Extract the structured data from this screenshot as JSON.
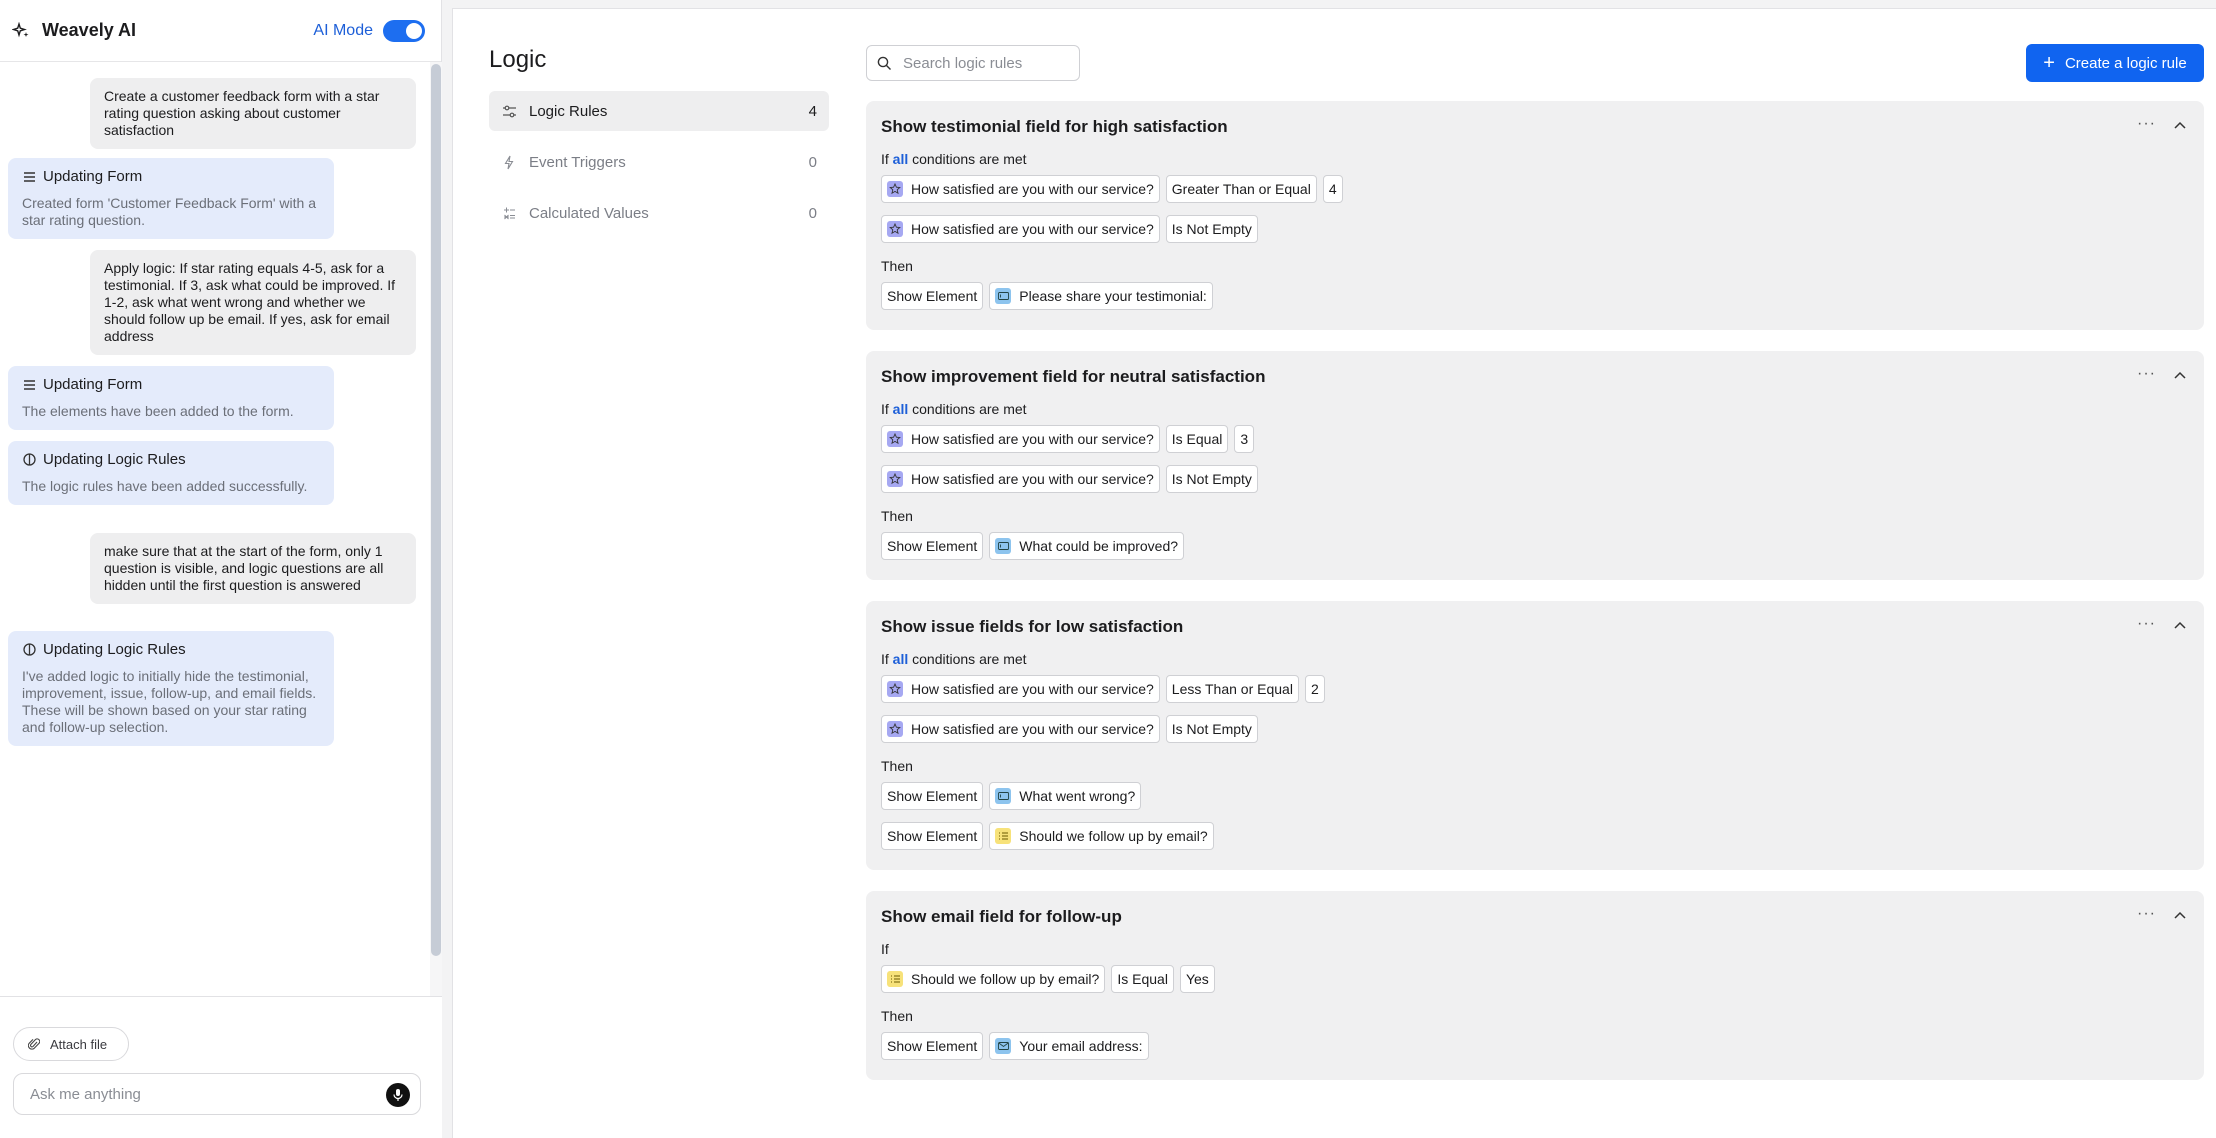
{
  "chat": {
    "brand": "Weavely AI",
    "ai_mode_label": "AI Mode",
    "messages": [
      {
        "role": "user",
        "text": "Create a customer feedback form with a star rating question asking about customer satisfaction"
      },
      {
        "role": "ai",
        "title": "Updating Form",
        "icon": "list-icon",
        "body": "Created form 'Customer Feedback Form' with a star rating question."
      },
      {
        "role": "user",
        "text": "Apply logic: If star rating equals 4-5, ask for a testimonial. If 3, ask what could be improved. If 1-2, ask what went wrong and whether we should follow up be email. If yes, ask for email address"
      },
      {
        "role": "ai",
        "title": "Updating Form",
        "icon": "list-icon",
        "body": "The elements have been added to the form."
      },
      {
        "role": "ai",
        "title": "Updating Logic Rules",
        "icon": "logic-icon",
        "body": "The logic rules have been added successfully."
      },
      {
        "role": "user",
        "text": "make sure that at the start of the form, only 1 question is visible, and logic questions are all hidden until the first question is answered"
      },
      {
        "role": "ai",
        "title": "Updating Logic Rules",
        "icon": "logic-icon",
        "body": "I've added logic to initially hide the testimonial, improvement, issue, follow-up, and email fields. These will be shown based on your star rating and follow-up selection."
      }
    ],
    "attach_label": "Attach file",
    "input_placeholder": "Ask me anything"
  },
  "main": {
    "title": "Logic",
    "nav": [
      {
        "label": "Logic Rules",
        "count": "4",
        "icon": "rules-icon",
        "active": true
      },
      {
        "label": "Event Triggers",
        "count": "0",
        "icon": "bolt-icon",
        "active": false
      },
      {
        "label": "Calculated Values",
        "count": "0",
        "icon": "calc-icon",
        "active": false
      }
    ],
    "search_placeholder": "Search logic rules",
    "create_label": "Create a logic rule",
    "if_prefix": "If",
    "all_word": "all",
    "conditions_suffix": "conditions are met",
    "then_label": "Then",
    "rules": [
      {
        "title": "Show testimonial field for high satisfaction",
        "if_all": true,
        "conditions": [
          {
            "question": "How satisfied are you with our service?",
            "icon": "star",
            "operator": "Greater Than or Equal",
            "value": "4"
          },
          {
            "question": "How satisfied are you with our service?",
            "icon": "star",
            "operator": "Is Not Empty",
            "value": ""
          }
        ],
        "actions": [
          {
            "action": "Show Element",
            "target": "Please share your testimonial:",
            "icon": "text"
          }
        ]
      },
      {
        "title": "Show improvement field for neutral satisfaction",
        "if_all": true,
        "conditions": [
          {
            "question": "How satisfied are you with our service?",
            "icon": "star",
            "operator": "Is Equal",
            "value": "3"
          },
          {
            "question": "How satisfied are you with our service?",
            "icon": "star",
            "operator": "Is Not Empty",
            "value": ""
          }
        ],
        "actions": [
          {
            "action": "Show Element",
            "target": "What could be improved?",
            "icon": "text"
          }
        ]
      },
      {
        "title": "Show issue fields for low satisfaction",
        "if_all": true,
        "conditions": [
          {
            "question": "How satisfied are you with our service?",
            "icon": "star",
            "operator": "Less Than or Equal",
            "value": "2"
          },
          {
            "question": "How satisfied are you with our service?",
            "icon": "star",
            "operator": "Is Not Empty",
            "value": ""
          }
        ],
        "actions": [
          {
            "action": "Show Element",
            "target": "What went wrong?",
            "icon": "text"
          },
          {
            "action": "Show Element",
            "target": "Should we follow up by email?",
            "icon": "list"
          }
        ]
      },
      {
        "title": "Show email field for follow-up",
        "if_all": false,
        "conditions": [
          {
            "question": "Should we follow up by email?",
            "icon": "list",
            "operator": "Is Equal",
            "value": "Yes"
          }
        ],
        "actions": [
          {
            "action": "Show Element",
            "target": "Your email address:",
            "icon": "mail"
          }
        ]
      }
    ]
  }
}
